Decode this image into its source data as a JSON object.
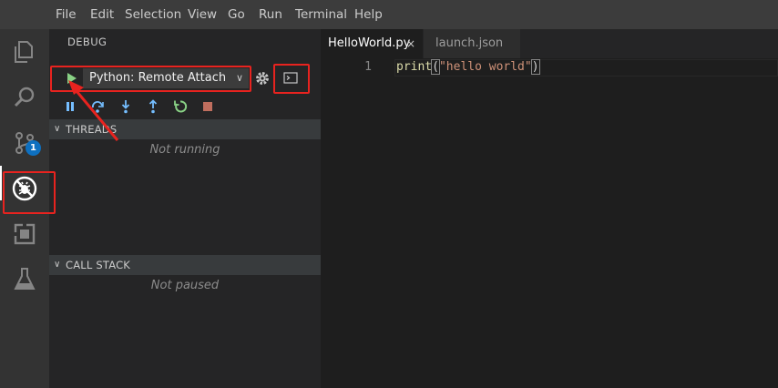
{
  "menu": {
    "items": [
      "File",
      "Edit",
      "Selection",
      "View",
      "Go",
      "Run",
      "Terminal",
      "Help"
    ]
  },
  "activity_bar": {
    "items": [
      "files-icon",
      "search-icon",
      "source-control-icon",
      "debug-icon",
      "extensions-icon",
      "test-flask-icon"
    ],
    "scm_badge": "1"
  },
  "sidebar": {
    "title": "DEBUG",
    "config_selected": "Python: Remote Attach",
    "toolbar": [
      "pause-icon",
      "step-over-icon",
      "step-into-icon",
      "step-out-icon",
      "restart-icon",
      "stop-icon"
    ],
    "threads": {
      "label": "THREADS",
      "message": "Not running"
    },
    "callstack": {
      "label": "CALL STACK",
      "message": "Not paused"
    }
  },
  "editor": {
    "tabs": [
      {
        "label": "HelloWorld.py",
        "active": true,
        "close": "×"
      },
      {
        "label": "launch.json",
        "active": false
      }
    ],
    "lines": [
      {
        "number": "1",
        "fn": "print",
        "open": "(",
        "str": "\"hello world\"",
        "close": ")"
      }
    ]
  },
  "colors": {
    "annotation": "#e8231f",
    "play": "#89d185",
    "accent": "#75beff",
    "restart": "#89d185",
    "stop": "#f48771"
  }
}
